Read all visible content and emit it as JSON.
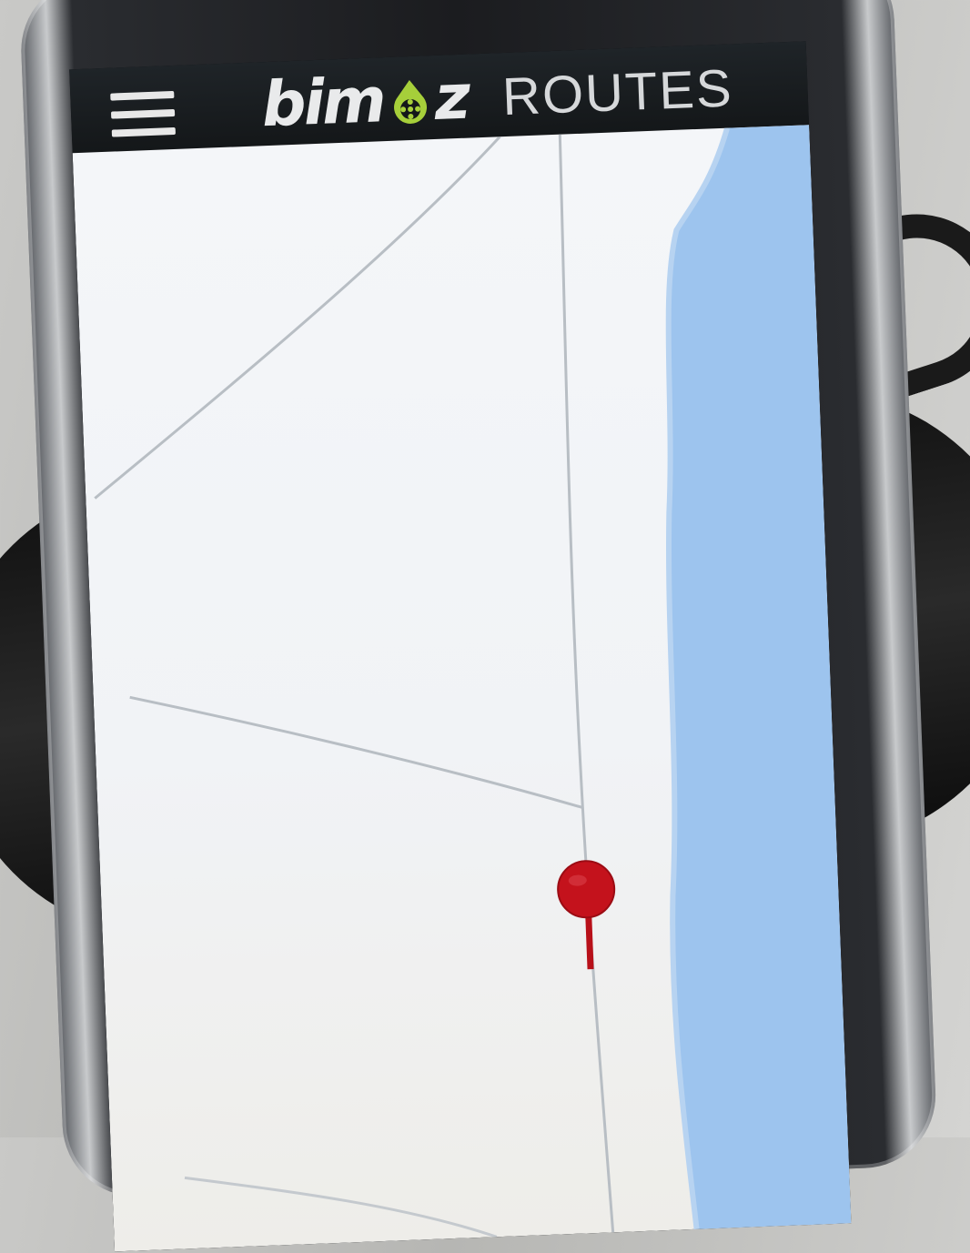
{
  "app": {
    "brand_text": "bimoz",
    "section_title": "ROUTES"
  },
  "header": {
    "menu_icon": "hamburger-menu-icon"
  },
  "map": {
    "marker_icon": "map-pin-icon",
    "water_color": "#9dc4ee",
    "land_color": "#f3f5f8",
    "road_color": "#b8bec4",
    "marker_color": "#c4121c",
    "brand_accent_color": "#a6cf3a"
  }
}
